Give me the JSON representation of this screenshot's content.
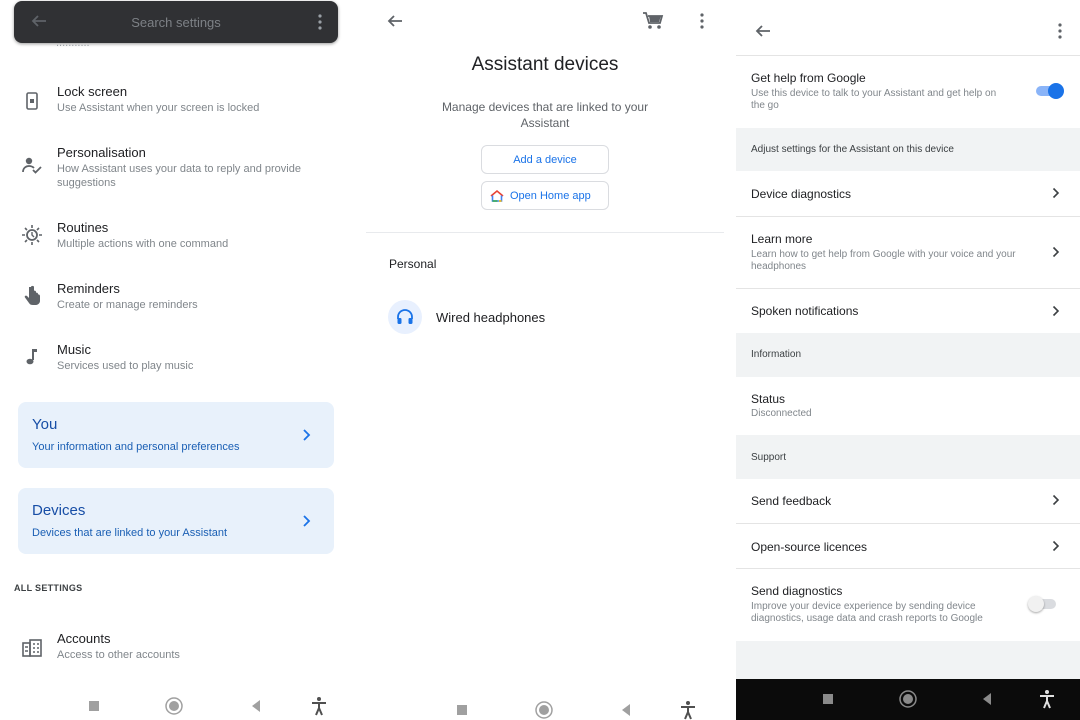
{
  "panel1": {
    "search_placeholder": "Search settings",
    "items": [
      {
        "title": "Lock screen",
        "sub": "Use Assistant when your screen is locked",
        "icon": "lock-screen-icon"
      },
      {
        "title": "Personalisation",
        "sub": "How Assistant uses your data to reply and provide suggestions",
        "icon": "person-check-icon"
      },
      {
        "title": "Routines",
        "sub": "Multiple actions with one command",
        "icon": "routines-icon"
      },
      {
        "title": "Reminders",
        "sub": "Create or manage reminders",
        "icon": "reminder-hand-icon"
      },
      {
        "title": "Music",
        "sub": "Services used to play music",
        "icon": "music-note-icon"
      }
    ],
    "cards": [
      {
        "title": "You",
        "sub": "Your information and personal preferences"
      },
      {
        "title": "Devices",
        "sub": "Devices that are linked to your Assistant"
      }
    ],
    "all_settings": "ALL SETTINGS",
    "accounts": {
      "title": "Accounts",
      "sub": "Access to other accounts",
      "icon": "accounts-icon"
    }
  },
  "panel2": {
    "title": "Assistant devices",
    "description": "Manage devices that are linked to your Assistant",
    "add_device": "Add a device",
    "open_home": "Open Home app",
    "section": "Personal",
    "device": "Wired headphones"
  },
  "panel3": {
    "get_help": {
      "title": "Get help from Google",
      "sub": "Use this device to talk to your Assistant and get help on the go",
      "on": true
    },
    "adjust_header": "Adjust settings for the Assistant on this device",
    "device_diagnostics": "Device diagnostics",
    "learn_more": {
      "title": "Learn more",
      "sub": "Learn how to get help from Google with your voice and your headphones"
    },
    "spoken_notifications": "Spoken notifications",
    "information_header": "Information",
    "status": {
      "title": "Status",
      "sub": "Disconnected"
    },
    "support_header": "Support",
    "send_feedback": "Send feedback",
    "open_source": "Open-source licences",
    "send_diagnostics": {
      "title": "Send diagnostics",
      "sub": "Improve your device experience by sending device diagnostics, usage data and crash reports to Google",
      "on": false
    }
  },
  "colors": {
    "accent": "#1a73e8",
    "card_bg": "#e8f1fb",
    "search_bg": "#303134",
    "section_bg": "#f1f3f4"
  }
}
